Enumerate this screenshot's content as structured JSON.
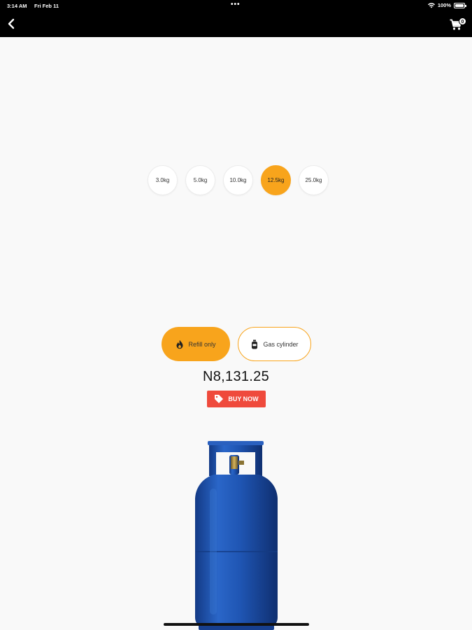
{
  "status_bar": {
    "time": "3:14 AM",
    "date": "Fri Feb 11",
    "dots": "•••",
    "battery": "100%"
  },
  "nav": {
    "back_icon": "chevron-left-icon",
    "cart_icon": "cart-icon",
    "cart_count": "0"
  },
  "sizes": [
    {
      "label": "3.0kg",
      "active": false
    },
    {
      "label": "5.0kg",
      "active": false
    },
    {
      "label": "10.0kg",
      "active": false
    },
    {
      "label": "12.5kg",
      "active": true
    },
    {
      "label": "25.0kg",
      "active": false
    }
  ],
  "options": {
    "refill": "Refill only",
    "cylinder": "Gas cylinder"
  },
  "price": "N8,131.25",
  "buy_button": "BUY NOW",
  "colors": {
    "accent": "#f8a41c",
    "buy": "#ef4a3c",
    "cylinder": "#1f55b3"
  }
}
